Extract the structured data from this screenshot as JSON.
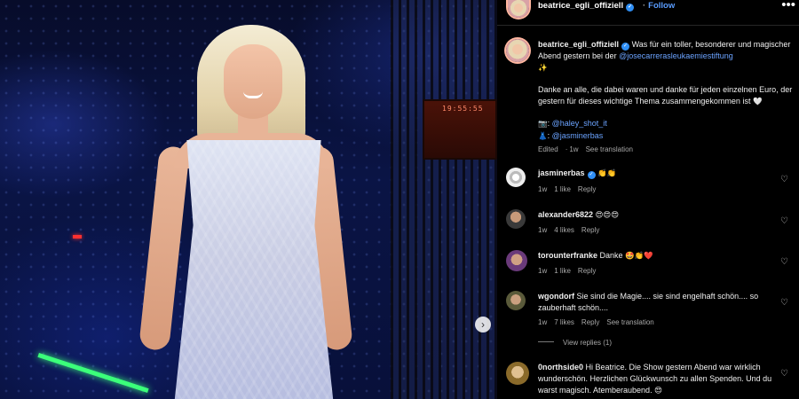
{
  "post": {
    "account_name": "beatrice_egli_offiziell",
    "follow_label": "Follow",
    "more_label": "•••",
    "next_label": "›"
  },
  "photo": {
    "monitor_text": "19:55:55"
  },
  "caption": {
    "username": "beatrice_egli_offiziell",
    "text_1": "Was für ein toller, besonderer und magischer Abend gestern bei der",
    "mention": "@josecarrerasleukaemiestiftung",
    "emoji_1": "✨",
    "paragraph_2": "Danke an alle, die dabei waren und danke für jeden einzelnen Euro, der gestern für dieses wichtige Thema zusammengekommen ist",
    "emoji_2": "🤍",
    "credit_1_icon": "📷",
    "credit_1": "@haley_shot_it",
    "credit_2_icon": "👗",
    "credit_2": "@jasminerbas",
    "edited": "Edited",
    "time": "1w",
    "see_translation": "See translation"
  },
  "comments": [
    {
      "username": "jasminerbas",
      "verified": true,
      "text": "",
      "emojis": "👏👏",
      "time": "1w",
      "likes": "1 like",
      "reply": "Reply",
      "translation": ""
    },
    {
      "username": "alexander6822",
      "verified": false,
      "text": "",
      "emojis": "😍😍😍",
      "time": "1w",
      "likes": "4 likes",
      "reply": "Reply",
      "translation": ""
    },
    {
      "username": "torounterfranke",
      "verified": false,
      "text": "Danke",
      "emojis": "🤩👏❤️",
      "time": "1w",
      "likes": "1 like",
      "reply": "Reply",
      "translation": ""
    },
    {
      "username": "wgondorf",
      "verified": false,
      "text": "Sie sind die Magie.... sie sind engelhaft schön.... so zauberhaft schön....",
      "emojis": "",
      "time": "1w",
      "likes": "7 likes",
      "reply": "Reply",
      "translation": "See translation"
    },
    {
      "username": "0northside0",
      "verified": false,
      "text": "Hi Beatrice. Die Show gestern Abend war wirklich wunderschön. Herzlichen Glückwunsch zu allen Spenden. Und du warst magisch. Atemberaubend.",
      "emojis": "😍",
      "time": "",
      "likes": "",
      "reply": "",
      "translation": ""
    }
  ],
  "view_replies": "View replies (1)",
  "icons": {
    "heart": "heart-outline-icon",
    "verified": "verified-badge-icon",
    "more": "more-options-icon",
    "next": "chevron-right-icon"
  },
  "colors": {
    "link": "#6ba3ff",
    "follow": "#5a9dff",
    "verified": "#2f8ff5",
    "background": "#000000",
    "muted": "#a8a8a8"
  }
}
